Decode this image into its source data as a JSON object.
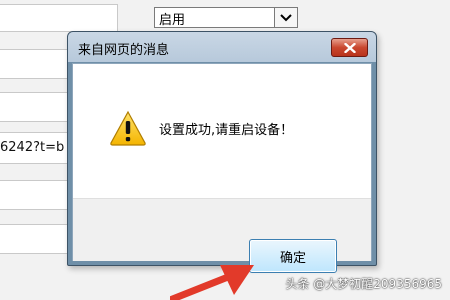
{
  "background": {
    "select_value": "启用",
    "partial_field_text": "6242?t=b"
  },
  "dialog": {
    "title": "来自网页的消息",
    "message": "设置成功,请重启设备！",
    "ok_label": "确定",
    "icon": "warning-icon"
  },
  "watermark": "头条 @大梦初醒209356965",
  "colors": {
    "titlebar": "#c9d7e5",
    "close_button": "#c9472f",
    "ok_button": "#bee6fd",
    "annotation_arrow": "#e23a2a"
  }
}
